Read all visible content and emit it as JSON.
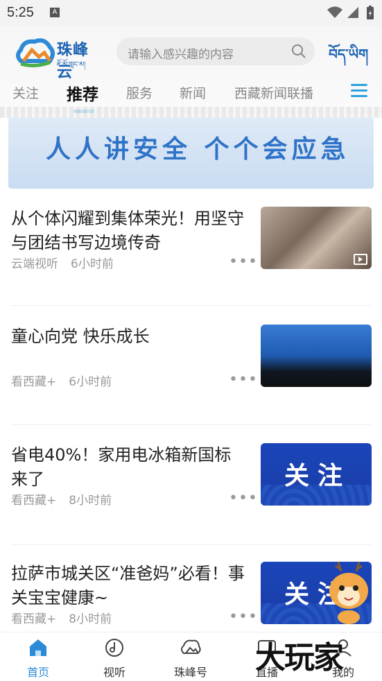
{
  "status": {
    "time": "5:25",
    "a_badge": "A"
  },
  "header": {
    "logo_text": "珠峰云",
    "logo_sub": "ཇོ་མོ་གླང་མ།",
    "search_placeholder": "请输入感兴趣的内容",
    "tibetan_link": "བོད་ཡིག"
  },
  "tabs": [
    {
      "label": "关注"
    },
    {
      "label": "推荐"
    },
    {
      "label": "服务"
    },
    {
      "label": "新闻"
    },
    {
      "label": "西藏新闻联播"
    }
  ],
  "banner": {
    "text": "人人讲安全 个个会应急"
  },
  "feed": [
    {
      "title": "从个体闪耀到集体荣光！用坚守与团结书写边境传奇",
      "source": "云端视听",
      "time": "6小时前",
      "thumb": "photo1",
      "video": true
    },
    {
      "title": "童心向党 快乐成长",
      "source": "看西藏+",
      "time": "6小时前",
      "thumb": "photo2",
      "video": false
    },
    {
      "title": "省电40%！家用电冰箱新国标来了",
      "source": "看西藏+",
      "time": "8小时前",
      "thumb": "blue",
      "thumb_text": "关注",
      "video": false
    },
    {
      "title": "拉萨市城关区“准爸妈”必看！事关宝宝健康~",
      "source": "看西藏+",
      "time": "8小时前",
      "thumb": "blue",
      "thumb_text": "关注",
      "video": false
    }
  ],
  "more_glyph": "•••",
  "bottom_nav": [
    {
      "label": "首页",
      "icon": "home-icon",
      "active": true
    },
    {
      "label": "视听",
      "icon": "music-icon",
      "active": false
    },
    {
      "label": "珠峰号",
      "icon": "cloud-icon",
      "active": false
    },
    {
      "label": "直播",
      "icon": "tv-icon",
      "active": false
    },
    {
      "label": "我的",
      "icon": "user-icon",
      "active": false
    }
  ],
  "watermark": "大玩家",
  "colors": {
    "accent": "#2d8ad6",
    "brand": "#1a62b3"
  }
}
